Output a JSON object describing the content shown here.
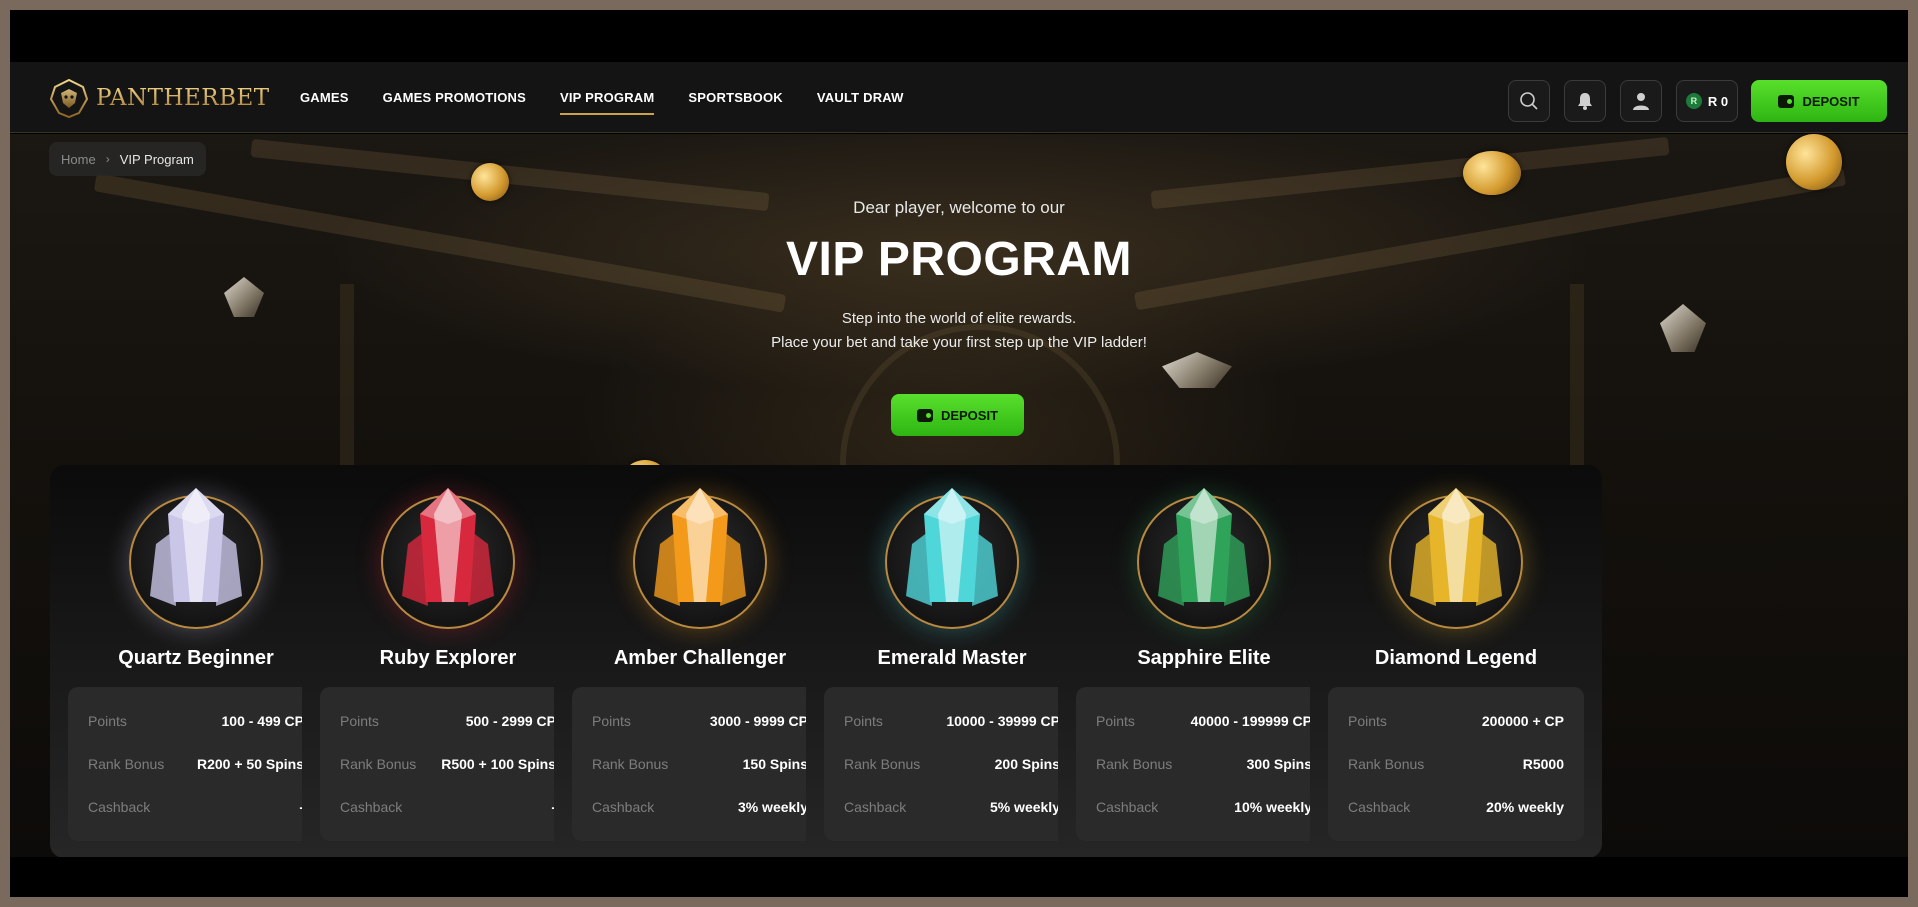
{
  "brand": {
    "name": "PANTHERBET"
  },
  "nav": [
    {
      "label": "GAMES"
    },
    {
      "label": "GAMES PROMOTIONS"
    },
    {
      "label": "VIP PROGRAM",
      "active": true
    },
    {
      "label": "SPORTSBOOK"
    },
    {
      "label": "VAULT DRAW"
    }
  ],
  "header": {
    "balance_currency_icon": "R",
    "balance": "R 0",
    "deposit_label": "DEPOSIT",
    "icons": [
      "search-icon",
      "bell-icon",
      "user-icon",
      "wallet-icon"
    ]
  },
  "breadcrumb": {
    "home": "Home",
    "current": "VIP Program"
  },
  "hero": {
    "welcome": "Dear player, welcome to our",
    "title": "VIP PROGRAM",
    "subtitle_line1": "Step into the world of elite rewards.",
    "subtitle_line2": "Place your bet and take your first step up the VIP ladder!",
    "deposit_label": "DEPOSIT"
  },
  "labels": {
    "points": "Points",
    "rank_bonus": "Rank Bonus",
    "cashback": "Cashback"
  },
  "tiers": [
    {
      "name": "Quartz Beginner",
      "points": "100 - 499 CP",
      "rank_bonus": "R200 + 50 Spins",
      "cashback": "-",
      "gem_color": "#c9c6e8"
    },
    {
      "name": "Ruby Explorer",
      "points": "500 - 2999 CP",
      "rank_bonus": "R500 + 100 Spins",
      "cashback": "-",
      "gem_color": "#d8283d"
    },
    {
      "name": "Amber Challenger",
      "points": "3000 - 9999 CP",
      "rank_bonus": "150 Spins",
      "cashback": "3% weekly",
      "gem_color": "#f39a1a"
    },
    {
      "name": "Emerald Master",
      "points": "10000 - 39999 CP",
      "rank_bonus": "200 Spins",
      "cashback": "5% weekly",
      "gem_color": "#4fd6d9"
    },
    {
      "name": "Sapphire Elite",
      "points": "40000 - 199999 CP",
      "rank_bonus": "300 Spins",
      "cashback": "10% weekly",
      "gem_color": "#2fa35a"
    },
    {
      "name": "Diamond Legend",
      "points": "200000 + CP",
      "rank_bonus": "R5000",
      "cashback": "20% weekly",
      "gem_color": "#e6b52a"
    }
  ],
  "colors": {
    "accent_gold": "#c9a24b",
    "deposit_green": "#3cc71d",
    "page_bg": "#000000"
  }
}
